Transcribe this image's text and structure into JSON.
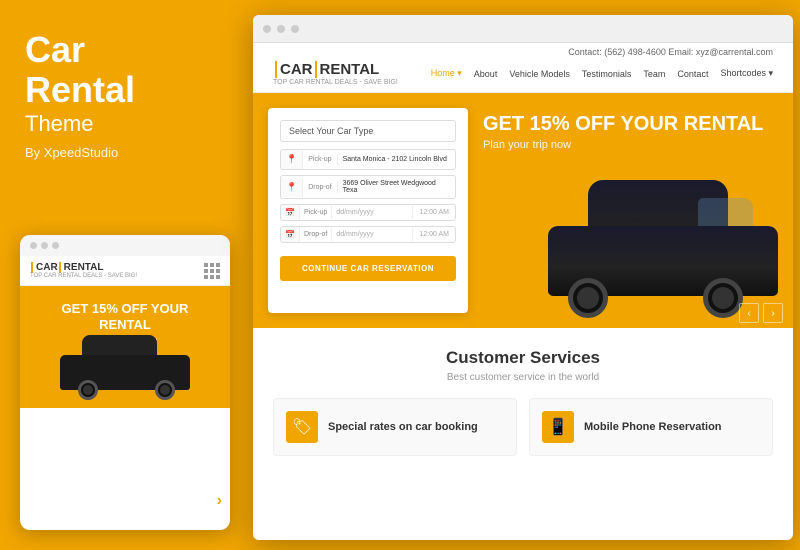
{
  "left": {
    "title_line1": "Car",
    "title_line2": "Rental",
    "subtitle": "Theme",
    "by": "By XpeedStudio"
  },
  "mobile": {
    "logo": "CAR",
    "logo2": "RENTAL",
    "tagline": "TOP CAR RENTAL DEALS - SAVE BIG!",
    "hero_title_line1": "GET 15% OFF YOUR",
    "hero_title_line2": "RENTAL",
    "hero_sub": "Plan your trip now"
  },
  "browser": {
    "contact_bar": "Contact: (562) 498-4600    Email: xyz@carrental.com",
    "logo": "CAR",
    "logo2": "RENTAL",
    "tagline": "TOP CAR RENTAL DEALS - SAVE BIG!",
    "nav": [
      "Home",
      "About",
      "Vehicle Models",
      "Testimonials",
      "Team",
      "Contact",
      "Shortcodes"
    ],
    "hero": {
      "discount": "GET 15% OFF YOUR RENTAL",
      "plan": "Plan your trip now"
    },
    "form": {
      "select_label": "Select Your Car Type",
      "pickup_icon": "📍",
      "pickup_label": "Pick-up",
      "pickup_value": "Santa Monica - 2102 Lincoln Blvd",
      "dropoff_icon": "📍",
      "dropoff_label": "Drop-of",
      "dropoff_value": "3669 Oliver Street Wedgwood Texa",
      "pickup_date_label": "Pick-up",
      "pickup_date": "dd/mm/yyyy",
      "pickup_time": "12:00 AM",
      "dropoff_date_label": "Drop-of",
      "dropoff_date": "dd/mm/yyyy",
      "dropoff_time": "12:00 AM",
      "btn": "CONTINUE CAR RESERVATION"
    },
    "services": {
      "title": "Customer Services",
      "subtitle": "Best customer service in the world",
      "card1": "Special rates on car booking",
      "card2": "Mobile Phone Reservation"
    }
  }
}
